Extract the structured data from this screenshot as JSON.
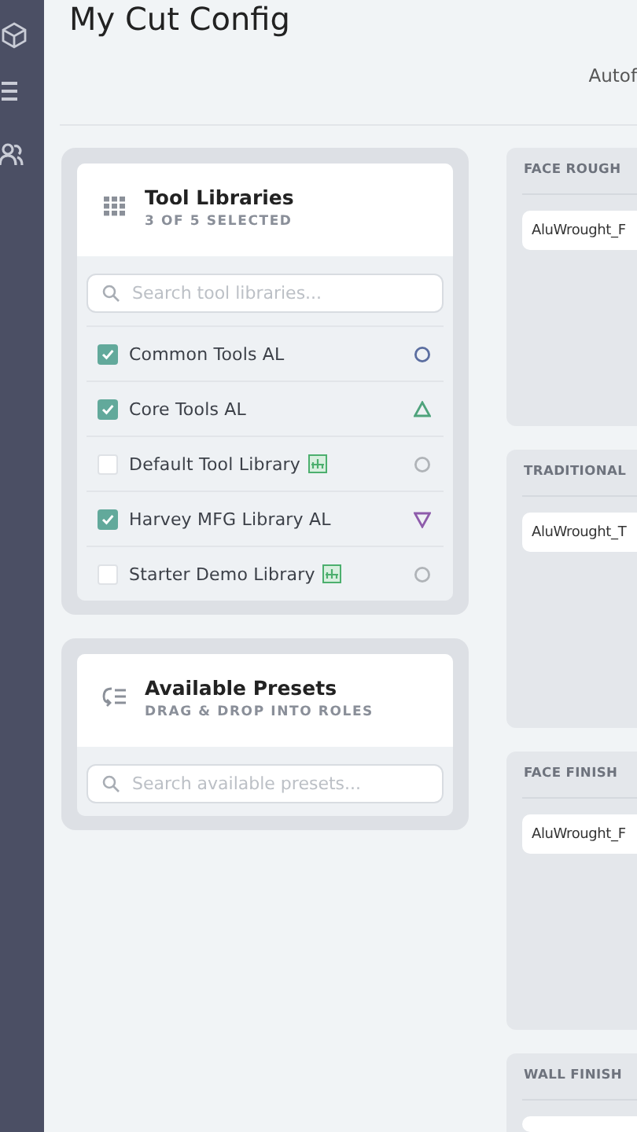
{
  "page": {
    "title": "My Cut Config",
    "toolbar_text": "Autof"
  },
  "tool_libraries": {
    "title": "Tool Libraries",
    "subtitle": "3 OF 5 SELECTED",
    "search": {
      "placeholder": "Search tool libraries..."
    },
    "items": [
      {
        "label": "Common Tools AL",
        "checked": true,
        "badge": false,
        "marker": {
          "kind": "circle",
          "color": "#5b6ea0"
        }
      },
      {
        "label": "Core Tools AL",
        "checked": true,
        "badge": false,
        "marker": {
          "kind": "triangle",
          "color": "#4fa37c"
        }
      },
      {
        "label": "Default Tool Library",
        "checked": false,
        "badge": true,
        "marker": {
          "kind": "circle",
          "color": "#b0b4b8"
        }
      },
      {
        "label": "Harvey MFG Library AL",
        "checked": true,
        "badge": false,
        "marker": {
          "kind": "triangle-down",
          "color": "#8e5cab"
        }
      },
      {
        "label": "Starter Demo Library",
        "checked": false,
        "badge": true,
        "marker": {
          "kind": "circle",
          "color": "#b0b4b8"
        }
      }
    ]
  },
  "available_presets": {
    "title": "Available Presets",
    "subtitle": "DRAG & DROP INTO ROLES",
    "search": {
      "placeholder": "Search available presets..."
    }
  },
  "roles": [
    {
      "title": "FACE ROUGH",
      "presets": [
        "AluWrought_F"
      ]
    },
    {
      "title": "TRADITIONAL",
      "presets": [
        "AluWrought_T"
      ]
    },
    {
      "title": "FACE FINISH",
      "presets": [
        "AluWrought_F"
      ]
    },
    {
      "title": "WALL FINISH"
    }
  ]
}
